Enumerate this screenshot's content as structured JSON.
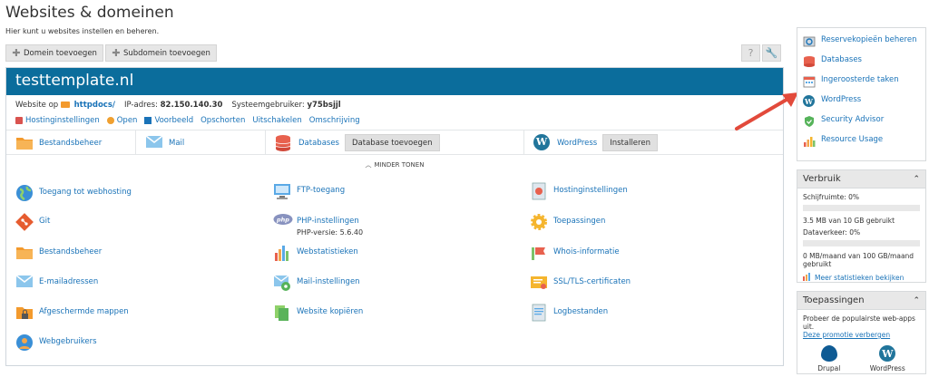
{
  "page": {
    "title": "Websites & domeinen",
    "subtitle": "Hier kunt u websites instellen en beheren."
  },
  "toolbar": {
    "add_domain": "Domein toevoegen",
    "add_subdomain": "Subdomein toevoegen",
    "help_icon": "?",
    "settings_icon": "wrench-icon"
  },
  "domain": {
    "name": "testtemplate.nl",
    "website_at_label": "Website op",
    "docroot": "httpdocs/",
    "ip_label": "IP-adres:",
    "ip": "82.150.140.30",
    "sysuser_label": "Systeemgebruiker:",
    "sysuser": "y75bsjjl",
    "links": [
      "Hostinginstellingen",
      "Open",
      "Voorbeeld",
      "Opschorten",
      "Uitschakelen",
      "Omschrijving"
    ],
    "quick": {
      "files": "Bestandsbeheer",
      "mail": "Mail",
      "databases": "Databases",
      "add_database": "Database toevoegen",
      "wordpress": "WordPress",
      "install": "Installeren"
    },
    "less_toggle": "MINDER TONEN",
    "tiles": {
      "webhosting_access": "Toegang tot webhosting",
      "ftp": "FTP-toegang",
      "hosting_settings": "Hostinginstellingen",
      "git": "Git",
      "php": "PHP-instellingen",
      "php_version": "PHP-versie: 5.6.40",
      "apps": "Toepassingen",
      "file_manager": "Bestandsbeheer",
      "web_stats": "Webstatistieken",
      "whois": "Whois-informatie",
      "email": "E-mailadressen",
      "mail_settings": "Mail-instellingen",
      "ssl": "SSL/TLS-certificaten",
      "protected_dirs": "Afgeschermde mappen",
      "copy_site": "Website kopiëren",
      "logs": "Logbestanden",
      "web_users": "Webgebruikers"
    }
  },
  "sidebar": {
    "links": [
      "Reservekopieën beheren",
      "Databases",
      "Ingeroosterde taken",
      "WordPress",
      "Security Advisor",
      "Resource Usage"
    ],
    "usage": {
      "title": "Verbruik",
      "disk_label": "Schijfruimte: 0%",
      "disk_fraction": 0.0,
      "disk_text": "3.5 MB van 10 GB gebruikt",
      "traffic_label": "Dataverkeer: 0%",
      "traffic_fraction": 0.0,
      "traffic_text": "0 MB/maand van 100 GB/maand gebruikt",
      "more_stats": "Meer statistieken bekijken"
    },
    "apps": {
      "title": "Toepassingen",
      "text": "Probeer de populairste web-apps uit.",
      "hide_link": "Deze promotie verbergen",
      "items": [
        "Drupal",
        "WordPress"
      ]
    }
  },
  "colors": {
    "header_bg": "#0b6d9c",
    "link": "#1a73b8",
    "arrow": "#e24a3b"
  }
}
